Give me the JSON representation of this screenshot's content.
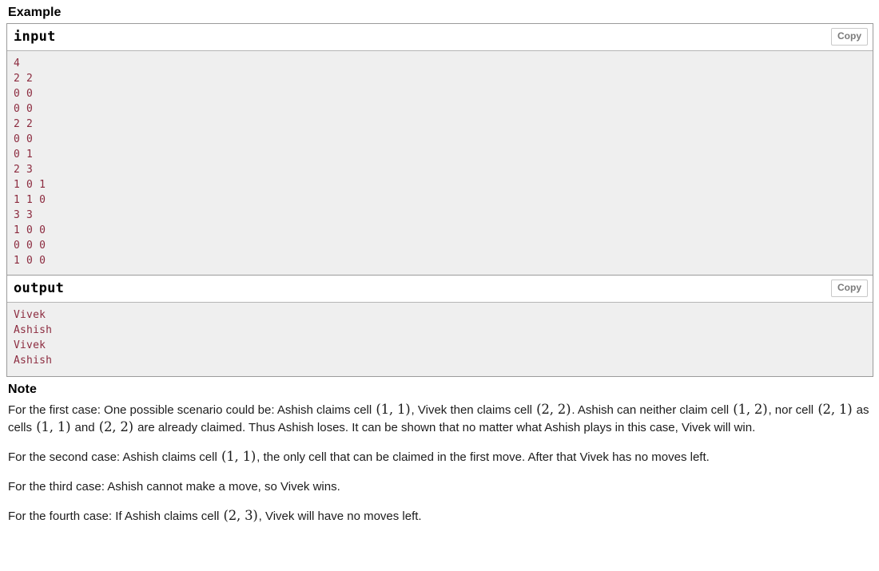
{
  "example": {
    "heading": "Example",
    "blocks": [
      {
        "title": "input",
        "copy_label": "Copy",
        "content": "4\n2 2\n0 0\n0 0\n2 2\n0 0\n0 1\n2 3\n1 0 1\n1 1 0\n3 3\n1 0 0\n0 0 0\n1 0 0"
      },
      {
        "title": "output",
        "copy_label": "Copy",
        "content": "Vivek\nAshish\nVivek\nAshish"
      }
    ]
  },
  "note": {
    "heading": "Note",
    "paragraphs": [
      {
        "parts": [
          {
            "type": "text",
            "value": "For the first case: One possible scenario could be: Ashish claims cell "
          },
          {
            "type": "math",
            "value": "(1, 1)"
          },
          {
            "type": "text",
            "value": ", Vivek then claims cell "
          },
          {
            "type": "math",
            "value": "(2, 2)"
          },
          {
            "type": "text",
            "value": ". Ashish can neither claim cell "
          },
          {
            "type": "math",
            "value": "(1, 2)"
          },
          {
            "type": "text",
            "value": ", nor cell "
          },
          {
            "type": "math",
            "value": "(2, 1)"
          },
          {
            "type": "text",
            "value": " as cells "
          },
          {
            "type": "math",
            "value": "(1, 1)"
          },
          {
            "type": "text",
            "value": " and "
          },
          {
            "type": "math",
            "value": "(2, 2)"
          },
          {
            "type": "text",
            "value": " are already claimed. Thus Ashish loses. It can be shown that no matter what Ashish plays in this case, Vivek will win."
          }
        ]
      },
      {
        "parts": [
          {
            "type": "text",
            "value": "For the second case: Ashish claims cell "
          },
          {
            "type": "math",
            "value": "(1, 1)"
          },
          {
            "type": "text",
            "value": ", the only cell that can be claimed in the first move. After that Vivek has no moves left."
          }
        ]
      },
      {
        "parts": [
          {
            "type": "text",
            "value": "For the third case: Ashish cannot make a move, so Vivek wins."
          }
        ]
      },
      {
        "parts": [
          {
            "type": "text",
            "value": "For the fourth case: If Ashish claims cell "
          },
          {
            "type": "math",
            "value": "(2, 3)"
          },
          {
            "type": "text",
            "value": ", Vivek will have no moves left."
          }
        ]
      }
    ]
  },
  "colors": {
    "code_text": "#8c2b3f",
    "code_bg": "#efefef",
    "panel_border": "#9b9b9b",
    "copy_border": "#c8c8c8",
    "copy_text": "#7a7a7a"
  }
}
